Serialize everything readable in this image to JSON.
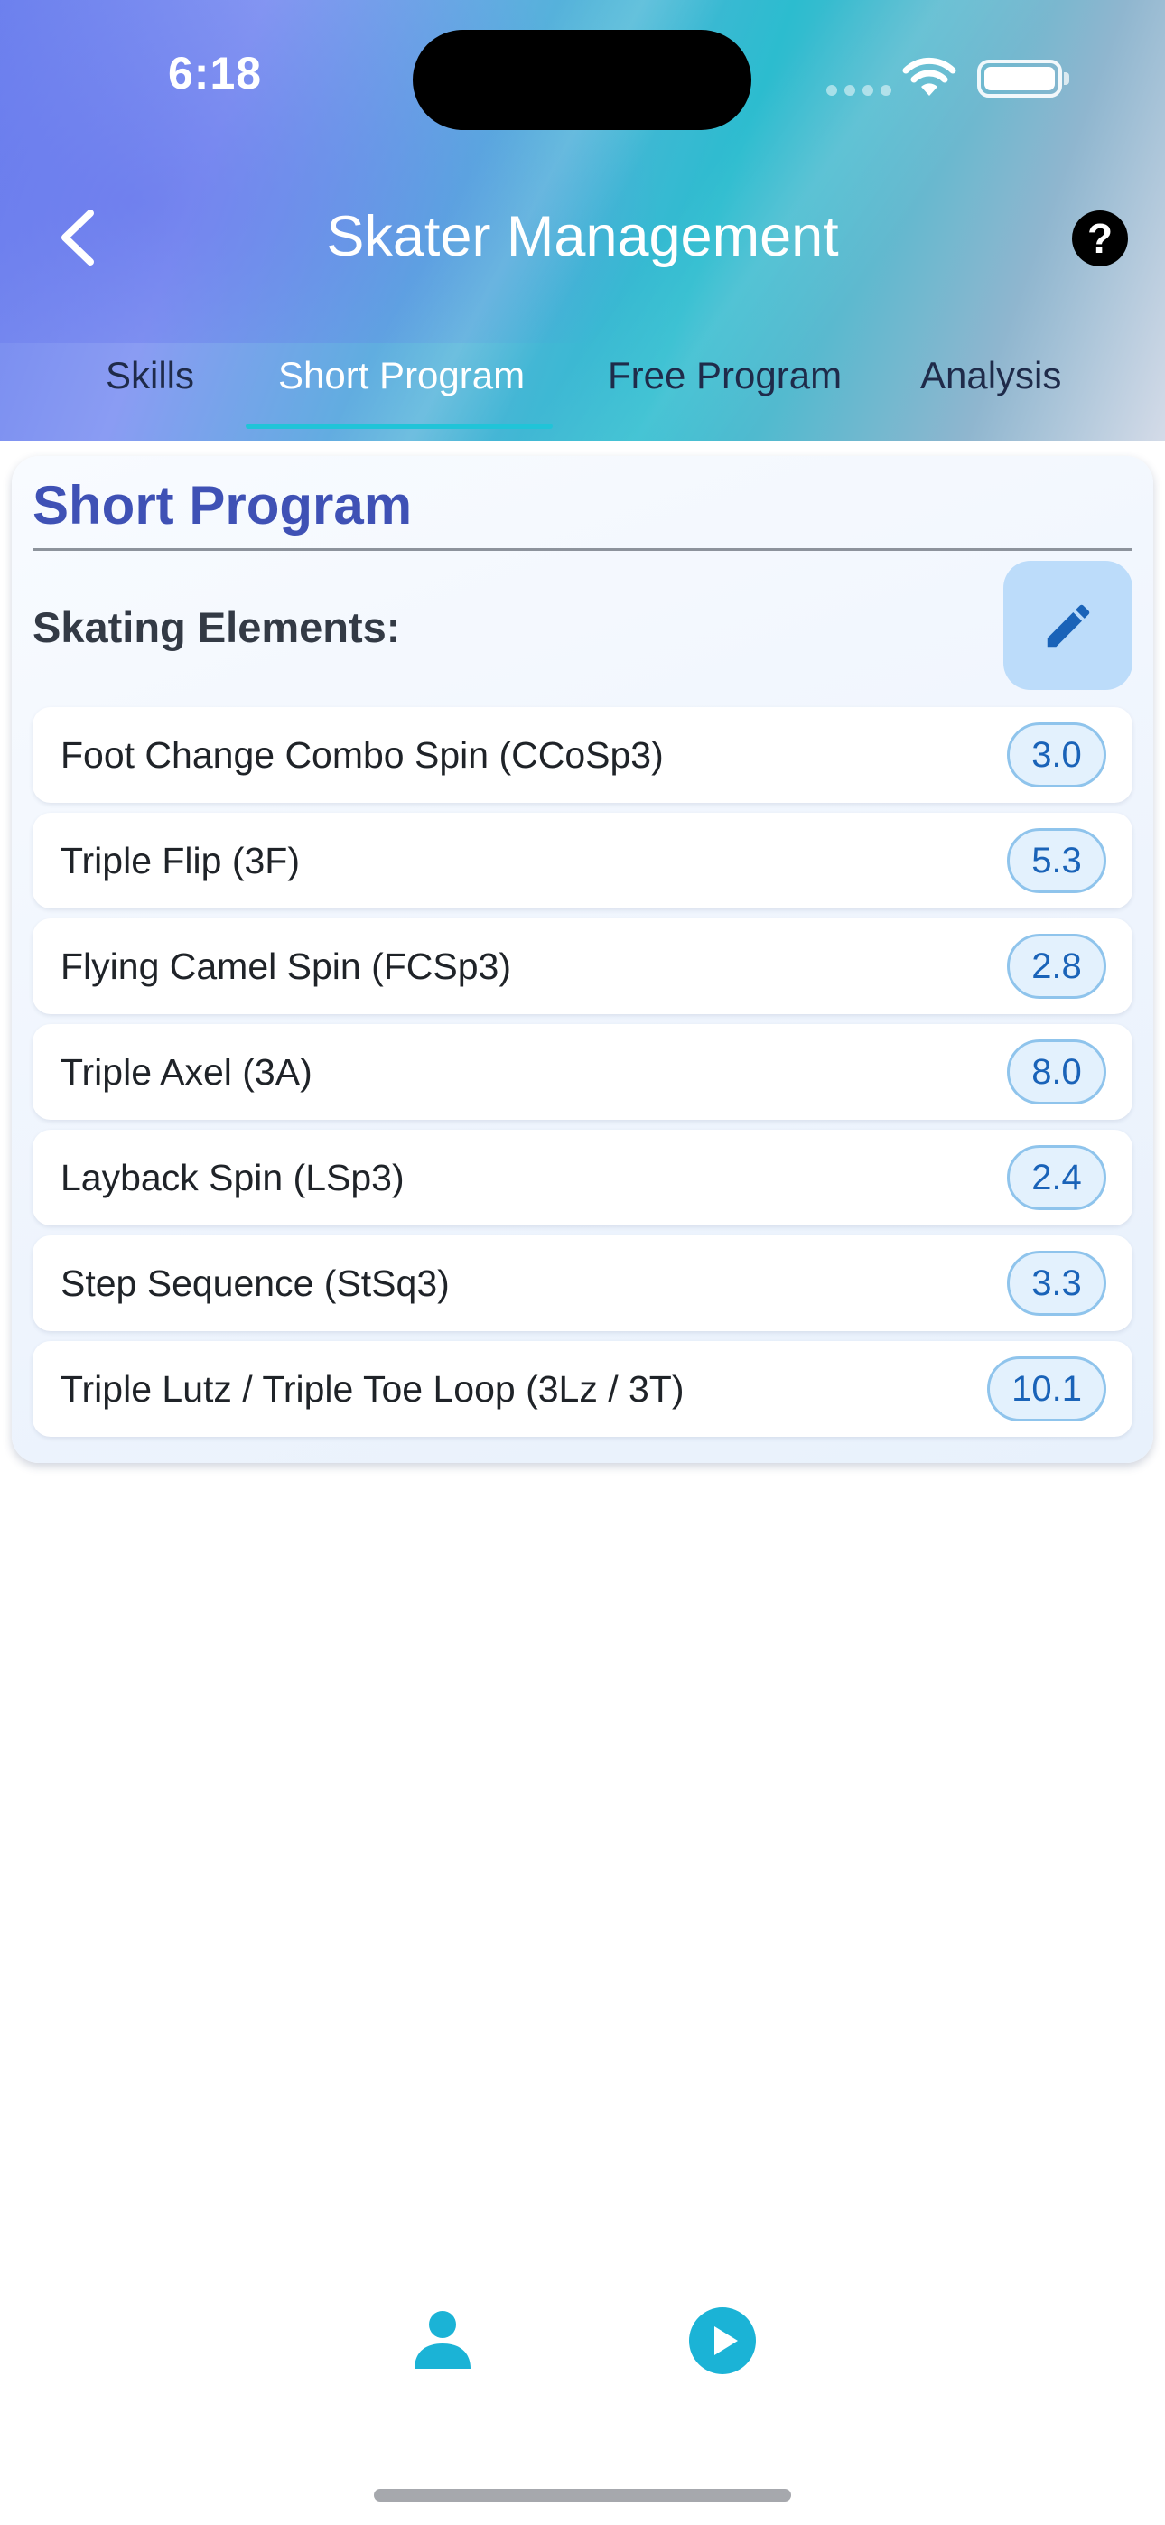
{
  "status_bar": {
    "time": "6:18"
  },
  "nav": {
    "title": "Skater Management",
    "back_icon": "chevron-left-icon",
    "help_icon": "help-circle-icon",
    "help_glyph": "?"
  },
  "tabs": [
    {
      "label": "Skills",
      "active": false
    },
    {
      "label": "Short Program",
      "active": true
    },
    {
      "label": "Free Program",
      "active": false
    },
    {
      "label": "Analysis",
      "active": false
    }
  ],
  "card": {
    "title": "Short Program",
    "section_label": "Skating Elements:",
    "edit_icon": "pencil-icon"
  },
  "elements": [
    {
      "name": "Foot Change Combo Spin (CCoSp3)",
      "score": "3.0"
    },
    {
      "name": "Triple Flip (3F)",
      "score": "5.3"
    },
    {
      "name": "Flying Camel Spin (FCSp3)",
      "score": "2.8"
    },
    {
      "name": "Triple Axel (3A)",
      "score": "8.0"
    },
    {
      "name": "Layback Spin (LSp3)",
      "score": "2.4"
    },
    {
      "name": "Step Sequence (StSq3)",
      "score": "3.3"
    },
    {
      "name": "Triple Lutz / Triple Toe Loop (3Lz / 3T)",
      "score": "10.1"
    }
  ],
  "bottom_bar": {
    "left_icon": "person-icon",
    "right_icon": "play-circle-icon"
  },
  "colors": {
    "accent": "#3f51b5",
    "tab_indicator": "#20c4d8",
    "score_text": "#1a63b8",
    "score_border": "#8fc4ec",
    "bottom_icons": "#1bb3d6"
  }
}
